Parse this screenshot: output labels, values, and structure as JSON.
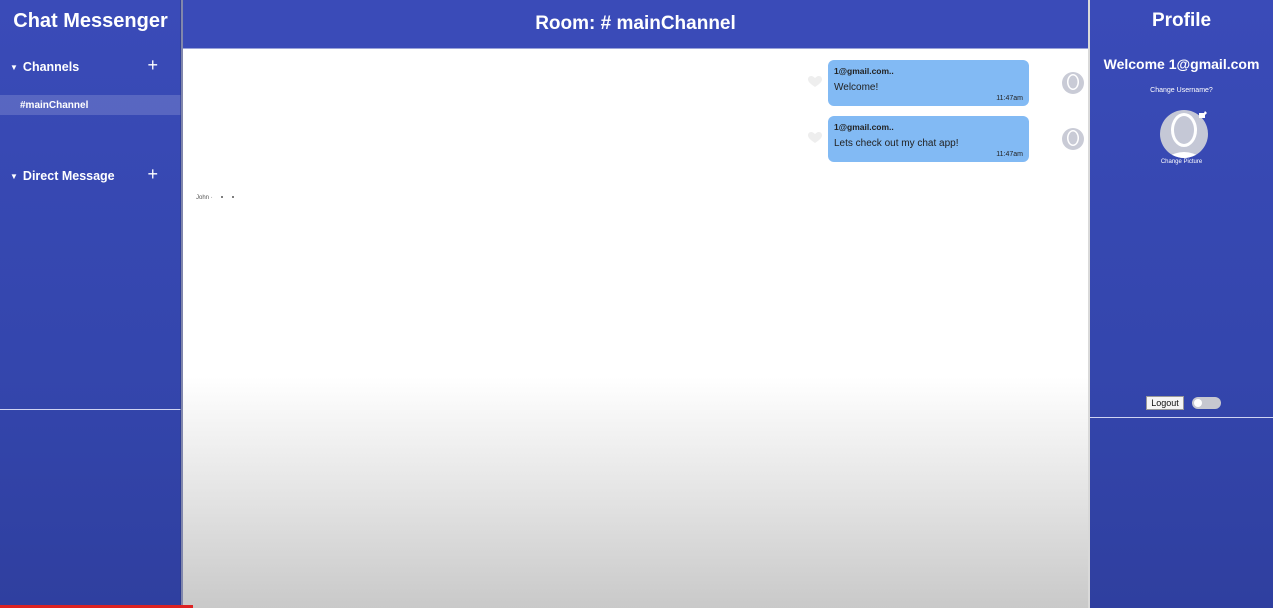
{
  "sidebar": {
    "app_title": "Chat Messenger",
    "channels_label": "Channels",
    "channels": [
      {
        "label": "#mainChannel"
      }
    ],
    "direct_message_label": "Direct Message",
    "add_symbol": "+",
    "caret_symbol": "▼"
  },
  "room": {
    "title": "Room: # mainChannel"
  },
  "messages": [
    {
      "sender": "1@gmail.com..",
      "text": "Welcome!",
      "time": "11:47am"
    },
    {
      "sender": "1@gmail.com..",
      "text": "Lets check out my chat app!",
      "time": "11:47am"
    }
  ],
  "typing": {
    "user": "John",
    "separator": "·"
  },
  "profile": {
    "title": "Profile",
    "welcome": "Welcome 1@gmail.com",
    "change_username": "Change Username?",
    "change_picture": "Change Picture",
    "logout_label": "Logout"
  },
  "colors": {
    "sidebar_bg": "#3a4bb8",
    "bubble_bg": "#82baf4",
    "progress": "#dd2222"
  },
  "icons": {
    "heart": "heart-icon",
    "avatar": "user-avatar-icon",
    "edit_photo": "edit-photo-icon"
  }
}
